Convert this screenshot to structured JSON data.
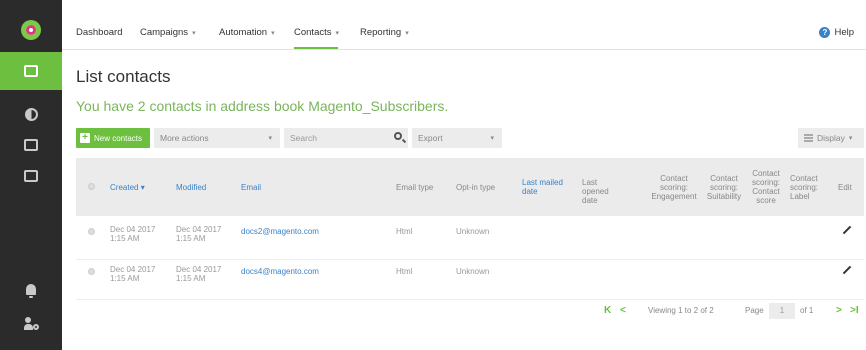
{
  "colors": {
    "accent": "#6cbf3f",
    "link": "#3a82c8",
    "sidebar": "#2b2b2b"
  },
  "sidebar": {
    "items": [
      {
        "icon": "logo-icon"
      },
      {
        "icon": "mail-icon",
        "active": true
      },
      {
        "icon": "contrast-icon"
      },
      {
        "icon": "close-box-icon"
      },
      {
        "icon": "report-icon"
      },
      {
        "icon": "bell-icon"
      },
      {
        "icon": "user-settings-icon"
      }
    ]
  },
  "nav": {
    "items": [
      {
        "label": "Dashboard",
        "dropdown": false
      },
      {
        "label": "Campaigns",
        "dropdown": true
      },
      {
        "label": "Automation",
        "dropdown": true
      },
      {
        "label": "Contacts",
        "dropdown": true,
        "active": true
      },
      {
        "label": "Reporting",
        "dropdown": true
      }
    ],
    "help": "Help"
  },
  "page": {
    "title": "List contacts",
    "subtitle": "You have 2 contacts in address book Magento_Subscribers."
  },
  "toolbar": {
    "new_contacts": "New contacts",
    "more_actions": "More actions",
    "search_placeholder": "Search",
    "export": "Export",
    "display": "Display"
  },
  "table": {
    "headers": {
      "created": "Created",
      "modified": "Modified",
      "email": "Email",
      "email_type": "Email type",
      "optin_type": "Opt-in type",
      "last_mailed": "Last mailed date",
      "last_opened": "Last opened date",
      "scoring_engagement": "Contact scoring: Engagement",
      "scoring_suitability": "Contact scoring: Suitability",
      "scoring_score": "Contact scoring: Contact score",
      "scoring_label": "Contact scoring: Label",
      "edit": "Edit"
    },
    "rows": [
      {
        "created_date": "Dec 04 2017",
        "created_time": "1:15 AM",
        "modified_date": "Dec 04 2017",
        "modified_time": "1:15 AM",
        "email": "docs2@magento.com",
        "email_type": "Html",
        "optin_type": "Unknown"
      },
      {
        "created_date": "Dec 04 2017",
        "created_time": "1:15 AM",
        "modified_date": "Dec 04 2017",
        "modified_time": "1:15 AM",
        "email": "docs4@magento.com",
        "email_type": "Html",
        "optin_type": "Unknown"
      }
    ]
  },
  "pagination": {
    "first": "K",
    "prev": "<",
    "viewing": "Viewing 1 to 2 of 2",
    "page_label": "Page",
    "page_value": "1",
    "of_total": "of 1",
    "next": ">",
    "last": ">I"
  }
}
